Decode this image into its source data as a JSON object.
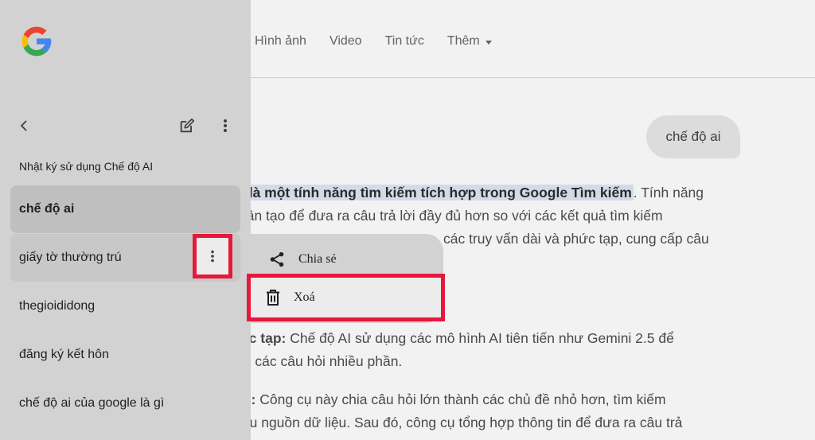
{
  "topnav": {
    "items": [
      "Hình ảnh",
      "Video",
      "Tin tức"
    ],
    "more_label": "Thêm"
  },
  "chat": {
    "query": "chế độ ai",
    "answer_lines": {
      "l1_prefix": ")",
      "l1_highlight": "là một tính năng tìm kiếm tích hợp trong Google Tìm kiếm",
      "l1_suffix": ". Tính năng",
      "l2": "hân tạo để đưa ra câu trả lời đầy đủ hơn so với các kết quả tìm kiếm",
      "l3_prefix": "",
      "l3": "các truy vấn dài và phức tạp, cung cấp câu"
    },
    "para2": {
      "bold": "ức tạp:",
      "l1": " Chế độ AI sử dụng các mô hình AI tiên tiến như Gemini 2.5 để",
      "l2": "rõ các câu hỏi nhiều phần."
    },
    "para3": {
      "bold": "in:",
      "l1": " Công cụ này chia câu hỏi lớn thành các chủ đề nhỏ hơn, tìm kiếm",
      "l2": "iều nguồn dữ liệu. Sau đó, công cụ tổng hợp thông tin để đưa ra câu trả"
    }
  },
  "sidebar": {
    "logo": "google-logo",
    "history_title": "Nhật ký sử dụng Chế độ AI",
    "history": [
      {
        "label": "chế độ ai"
      },
      {
        "label": "giấy tờ thường trú"
      },
      {
        "label": "thegioididong"
      },
      {
        "label": "đăng ký kết hôn"
      },
      {
        "label": "chế độ ai của google là gì"
      }
    ]
  },
  "menu": {
    "share_label": "Chia sẻ",
    "delete_label": "Xoá"
  },
  "colors": {
    "highlight_border": "#e8173c",
    "sidebar_bg": "#d2d2d2"
  }
}
